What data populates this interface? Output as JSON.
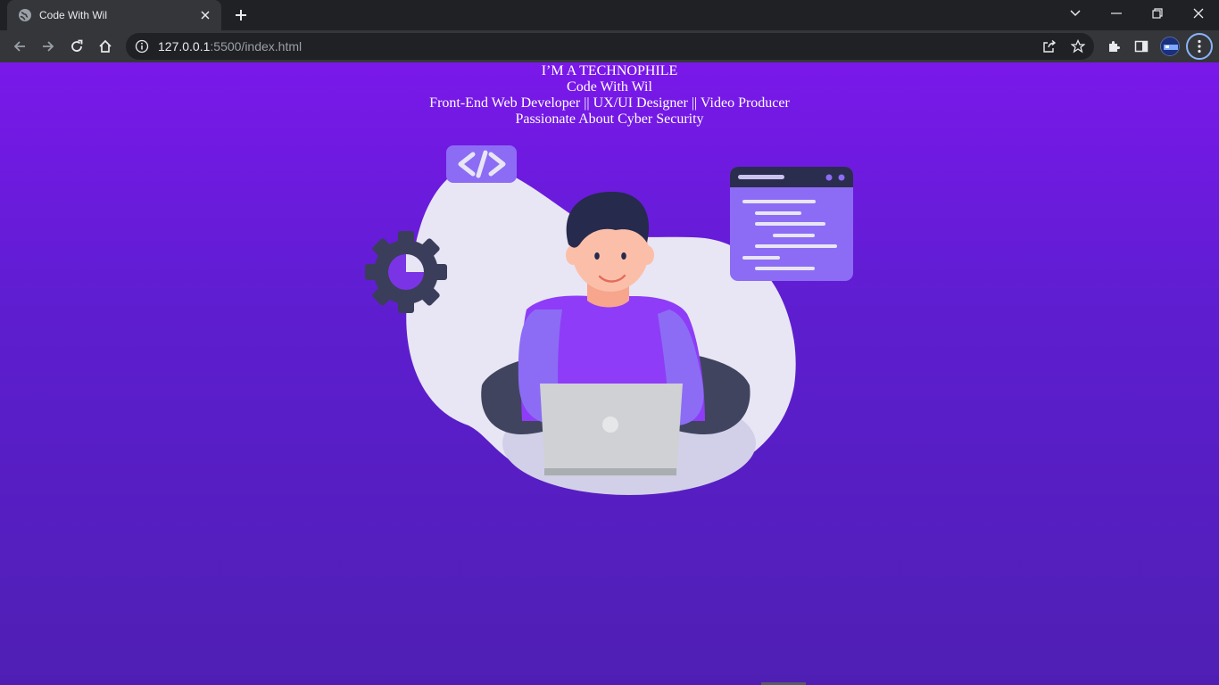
{
  "browser": {
    "tab": {
      "title": "Code With Wil"
    },
    "url": {
      "host": "127.0.0.1",
      "path": ":5500/index.html"
    }
  },
  "page": {
    "lines": [
      "I’M A TECHNOPHILE",
      "Code With Wil",
      "Front-End Web Developer || UX/UI Designer || Video Producer",
      "Passionate About Cyber Security"
    ],
    "illustration": {
      "icons": [
        "code-tag-icon",
        "gear-icon",
        "code-window-icon",
        "laptop-icon"
      ],
      "colors": {
        "purple": "#7c3aed",
        "lavender": "#8c6cf5",
        "skin": "#f7a58c",
        "dark": "#2b2d4f",
        "blob": "#e8e6f4"
      }
    }
  }
}
